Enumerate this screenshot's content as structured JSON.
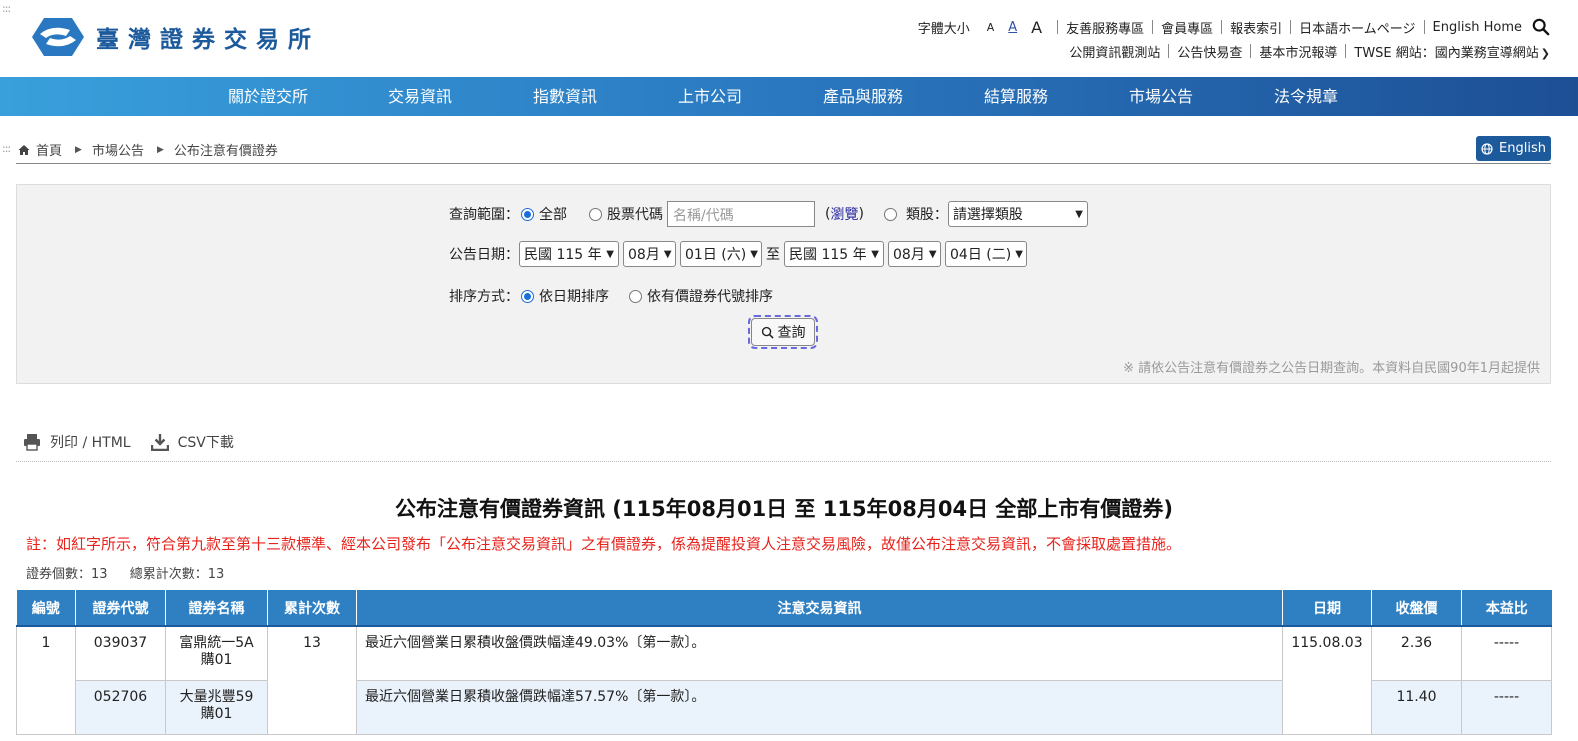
{
  "access_marks": [
    ":::",
    ":::"
  ],
  "brand": {
    "name": "臺灣證券交易所"
  },
  "utility": {
    "font_size_label": "字體大小",
    "font_sizes": [
      "A",
      "A",
      "A"
    ],
    "row1_links": [
      "友善服務專區",
      "會員專區",
      "報表索引",
      "日本語ホームページ",
      "English Home"
    ],
    "row2_links": [
      "公開資訊觀測站",
      "公告快易查",
      "基本市況報導"
    ],
    "site_select": "TWSE 網站：國內業務宣導網站"
  },
  "nav": [
    "關於證交所",
    "交易資訊",
    "指數資訊",
    "上市公司",
    "產品與服務",
    "結算服務",
    "市場公告",
    "法令規章"
  ],
  "breadcrumb": [
    "首頁",
    "市場公告",
    "公布注意有價證券"
  ],
  "english_button": "English",
  "query": {
    "range_label": "查詢範圍：",
    "opt_all": "全部",
    "opt_code": "股票代碼",
    "code_placeholder": "名稱/代碼",
    "browse_open": "(",
    "browse": "瀏覽",
    "browse_close": ")",
    "opt_category": "類股：",
    "category_select": "請選擇類股",
    "date_label": "公告日期：",
    "from_year": "民國 115 年",
    "from_month": "08月",
    "from_day": "01日 (六)",
    "to_word": "至",
    "to_year": "民國 115 年",
    "to_month": "08月",
    "to_day": "04日 (二)",
    "sort_label": "排序方式：",
    "sort_date": "依日期排序",
    "sort_code": "依有價證券代號排序",
    "submit": "查詢",
    "note": "※ 請依公告注意有價證券之公告日期查詢。本資料自民國90年1月起提供"
  },
  "tools": {
    "print": "列印 / HTML",
    "csv": "CSV下載"
  },
  "report": {
    "title": "公布注意有價證券資訊 (115年08月01日 至 115年08月04日 全部上市有價證券)",
    "note": "註：如紅字所示，符合第九款至第十三款標準、經本公司發布「公布注意交易資訊」之有價證券，係為提醒投資人注意交易風險，故僅公布注意交易資訊，不會採取處置措施。",
    "count_label": "證券個數：13",
    "total_label": "總累計次數：13"
  },
  "table": {
    "headers": [
      "編號",
      "證券代號",
      "證券名稱",
      "累計次數",
      "注意交易資訊",
      "日期",
      "收盤價",
      "本益比"
    ],
    "rows": [
      {
        "no": "1",
        "code": "039037",
        "name": "富鼎統一5A購01",
        "times": "13",
        "info": "最近六個營業日累積收盤價跌幅達49.03%〔第一款〕。",
        "date": "115.08.03",
        "close": "2.36",
        "pe": "-----"
      },
      {
        "code": "052706",
        "name": "大量兆豐59購01",
        "info": "最近六個營業日累積收盤價跌幅達57.57%〔第一款〕。",
        "close": "11.40",
        "pe": "-----"
      }
    ]
  },
  "colors": {
    "brand": "#1c5a9c",
    "nav_start": "#39a0dc",
    "nav_end": "#1d4f95",
    "table_header": "#2f80c3",
    "alert": "#e8231c"
  }
}
